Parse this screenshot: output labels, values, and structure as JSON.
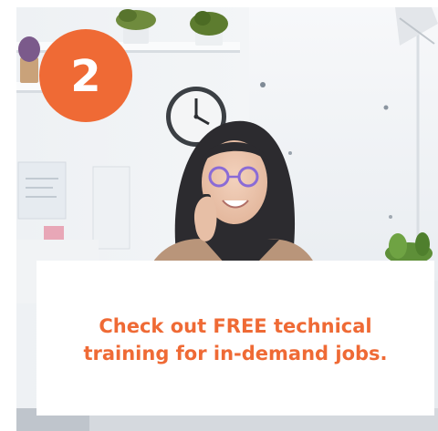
{
  "card": {
    "step_number": "2",
    "caption": "Check out FREE technical training for in-demand jobs."
  },
  "icons": {
    "step_badge": "numbered-circle"
  },
  "colors": {
    "accent": "#ef6a35",
    "caption_background": "#ffffff",
    "badge_text": "#ffffff"
  }
}
